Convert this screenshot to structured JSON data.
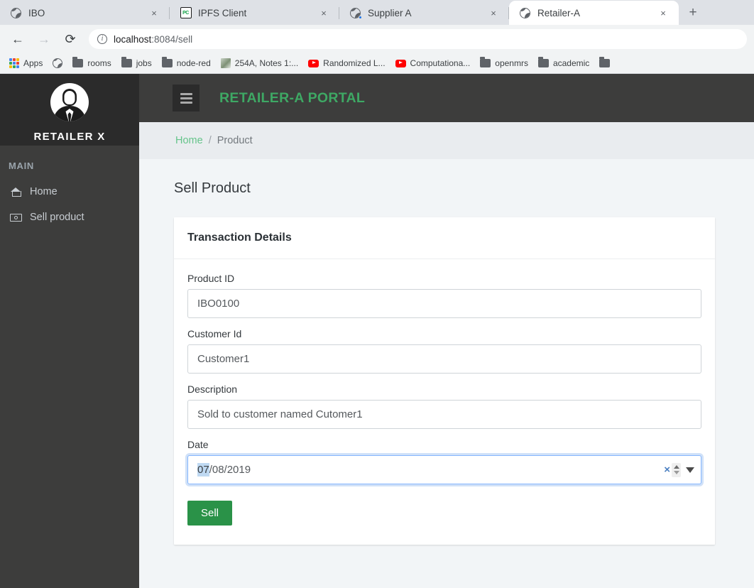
{
  "browser": {
    "tabs": [
      {
        "title": "IBO",
        "icon": "globe-icon",
        "active": false,
        "loading": false
      },
      {
        "title": "IPFS Client",
        "icon": "pc-icon",
        "active": false,
        "loading": false
      },
      {
        "title": "Supplier A",
        "icon": "globe-icon",
        "active": false,
        "loading": true
      },
      {
        "title": "Retailer-A",
        "icon": "globe-icon",
        "active": true,
        "loading": false
      }
    ],
    "new_tab_label": "+",
    "close_label": "×",
    "nav": {
      "back": "←",
      "forward": "→",
      "reload": "⟳"
    },
    "omnibox": {
      "info_icon": "i",
      "url_host": "localhost",
      "url_rest": ":8084/sell"
    },
    "bookmarks": [
      {
        "label": "Apps",
        "icon": "apps-grid-icon"
      },
      {
        "label": "",
        "icon": "globe-icon"
      },
      {
        "label": "rooms",
        "icon": "folder-icon"
      },
      {
        "label": "jobs",
        "icon": "folder-icon"
      },
      {
        "label": "node-red",
        "icon": "folder-icon"
      },
      {
        "label": "254A, Notes 1:...",
        "icon": "note-icon"
      },
      {
        "label": "Randomized L...",
        "icon": "youtube-icon"
      },
      {
        "label": "Computationa...",
        "icon": "youtube-icon"
      },
      {
        "label": "openmrs",
        "icon": "folder-icon"
      },
      {
        "label": "academic",
        "icon": "folder-icon"
      },
      {
        "label": "",
        "icon": "folder-icon"
      }
    ]
  },
  "sidebar": {
    "brand": "RETAILER X",
    "avatar_icon": "user-avatar-icon",
    "section_label": "MAIN",
    "items": [
      {
        "label": "Home",
        "icon": "home-icon"
      },
      {
        "label": "Sell product",
        "icon": "money-icon"
      }
    ]
  },
  "header": {
    "menu_icon": "hamburger-icon",
    "title": "RETAILER-A PORTAL",
    "title_color": "#3ea864"
  },
  "breadcrumb": {
    "home": "Home",
    "separator": "/",
    "current": "Product"
  },
  "main": {
    "page_title": "Sell Product",
    "card_title": "Transaction Details",
    "fields": [
      {
        "label": "Product ID",
        "value": "IBO0100"
      },
      {
        "label": "Customer Id",
        "value": "Customer1"
      },
      {
        "label": "Description",
        "value": "Sold to customer named Cutomer1"
      }
    ],
    "date_field": {
      "label": "Date",
      "selected_segment": "07",
      "rest": "/08/2019",
      "clear_label": "×",
      "spinner_icon": "spinner-up-down-icon",
      "dropdown_icon": "caret-down-icon",
      "focus_color": "#86b7fe",
      "selection_color": "#bfd9f2"
    },
    "submit_label": "Sell",
    "submit_color": "#2a9248"
  }
}
